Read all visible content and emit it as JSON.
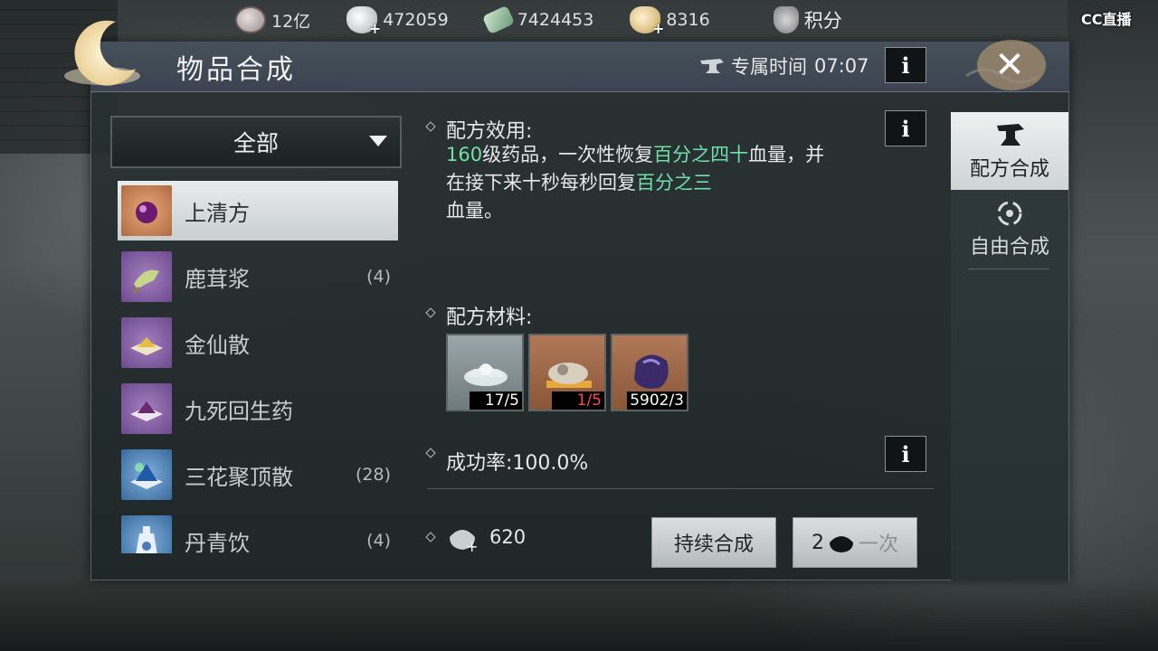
{
  "topbar": {
    "resources": [
      {
        "icon": "coin-icon",
        "value": "12亿"
      },
      {
        "icon": "silver-ingot-icon",
        "value": "472059"
      },
      {
        "icon": "jade-icon",
        "value": "7424453"
      },
      {
        "icon": "gold-ingot-icon",
        "value": "8316"
      }
    ],
    "points_label": "积分"
  },
  "watermark": "CC直播",
  "panel": {
    "title": "物品合成",
    "exclusive_time_label": "专属时间",
    "exclusive_time_value": "07:07"
  },
  "filter": {
    "selected": "全部"
  },
  "recipes": [
    {
      "name": "上清方",
      "count": "",
      "selected": true
    },
    {
      "name": "鹿茸浆",
      "count": "(4)",
      "selected": false
    },
    {
      "name": "金仙散",
      "count": "",
      "selected": false
    },
    {
      "name": "九死回生药",
      "count": "",
      "selected": false
    },
    {
      "name": "三花聚顶散",
      "count": "(28)",
      "selected": false
    },
    {
      "name": "丹青饮",
      "count": "(4)",
      "selected": false
    }
  ],
  "detail": {
    "effect_label": "配方效用:",
    "effect_parts": [
      {
        "text": "160",
        "hl": true
      },
      {
        "text": "级药品，一次性恢复",
        "hl": false
      },
      {
        "text": "百分之四十",
        "hl": true
      },
      {
        "text": "血量，并在接下来十秒每秒回复",
        "hl": false
      },
      {
        "text": "百分之三",
        "hl": true
      },
      {
        "text": "血量。",
        "hl": false
      }
    ],
    "materials_label": "配方材料:",
    "materials": [
      {
        "icon": "lotus-icon",
        "qty": "17/5",
        "insufficient": false
      },
      {
        "icon": "ore-icon",
        "qty": "1/5",
        "insufficient": true
      },
      {
        "icon": "crystal-icon",
        "qty": "5902/3",
        "insufficient": false
      }
    ],
    "success_rate_label": "成功率:",
    "success_rate_value": "100.0%",
    "cost_value": "620"
  },
  "actions": {
    "continuous_label": "持续合成",
    "once_cost": "2",
    "once_label": "一次"
  },
  "tabs": [
    {
      "label": "配方合成",
      "active": true
    },
    {
      "label": "自由合成",
      "active": false
    }
  ],
  "colors": {
    "highlight": "#6fe0a8",
    "insufficient": "#ff4a4a"
  }
}
